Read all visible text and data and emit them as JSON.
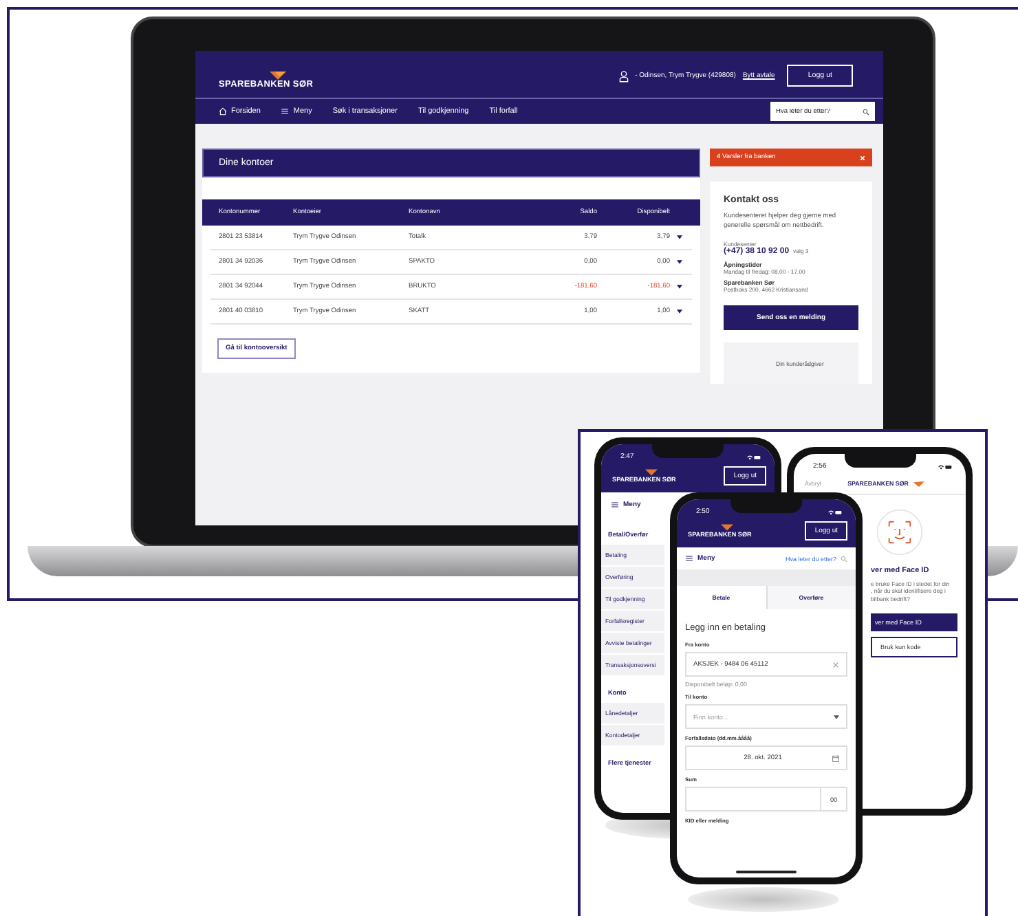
{
  "laptop": {
    "header": {
      "logo": "SPAREBANKEN SØR",
      "user": "- Odinsen, Trym Trygve (429808)",
      "switch_link": "Bytt avtale",
      "logout": "Logg ut"
    },
    "nav": {
      "items": [
        {
          "label": "Forsiden"
        },
        {
          "label": "Meny"
        },
        {
          "label": "Søk i transaksjoner"
        },
        {
          "label": "Til godkjenning"
        },
        {
          "label": "Til forfall"
        }
      ],
      "search": {
        "placeholder": "Hva leter du etter?"
      }
    },
    "accounts": {
      "title": "Dine kontoer",
      "columns": [
        "Kontonummer",
        "Kontoeier",
        "Kontonavn",
        "Saldo",
        "Disponibelt"
      ],
      "rows": [
        {
          "number": "2801 23 53814",
          "owner": "Trym Trygve Odinsen",
          "name": "Totalk",
          "balance": "3,79",
          "available": "3,79",
          "negative": false
        },
        {
          "number": "2801 34 92036",
          "owner": "Trym Trygve Odinsen",
          "name": "SPAKTO",
          "balance": "0,00",
          "available": "0,00",
          "negative": false
        },
        {
          "number": "2801 34 92044",
          "owner": "Trym Trygve Odinsen",
          "name": "BRUKTO",
          "balance": "-181,60",
          "available": "-181,60",
          "negative": true
        },
        {
          "number": "2801 40 03810",
          "owner": "Trym Trygve Odinsen",
          "name": "SKATT",
          "balance": "1,00",
          "available": "1,00",
          "negative": false
        }
      ],
      "button": "Gå til kontooversikt"
    },
    "alert": {
      "text": "4 Varsler fra banken"
    },
    "contact": {
      "title": "Kontakt oss",
      "intro": "Kundesenteret hjelper deg gjerne med generelle spørsmål om nettbedrift.",
      "phone_label": "Kundesenter",
      "phone": "(+47) 38 10 92 00",
      "phone_suffix": "valg 3",
      "hours_label": "Åpningstider",
      "hours": "Mandag til fredag: 08.00 - 17.00",
      "office_name": "Sparebanken Sør",
      "office_address": "Postboks 200, 4662 Kristiansand",
      "button": "Send oss en melding",
      "advisor_label": "Din kunderådgiver"
    }
  },
  "phone_menu": {
    "time": "2:47",
    "logo": "SPAREBANKEN SØR",
    "logout": "Logg ut",
    "menu": "Meny",
    "sections": [
      {
        "title": "Betal/Overfør",
        "items": [
          "Betaling",
          "Overføring",
          "Til godkjenning",
          "Forfallsregister",
          "Avviste betalinger",
          "Transaksjonsoversi"
        ]
      },
      {
        "title": "Konto",
        "items": [
          "Lånedetaljer",
          "Kontodetaljer"
        ]
      },
      {
        "title": "Flere tjenester"
      }
    ]
  },
  "phone_faceid": {
    "time": "2:56",
    "cancel": "Avbryt",
    "logo": "SPAREBANKEN SØR",
    "title": "ver med Face ID",
    "lines": [
      "e bruke Face ID i stedet for din",
      ", når du skal identifisere deg i",
      "bilbank bedrift?"
    ],
    "primary_button": "ver med Face ID",
    "secondary_button": "Bruk kun kode"
  },
  "phone_payment": {
    "time": "2:50",
    "logo": "SPAREBANKEN SØR",
    "logout": "Logg ut",
    "menu": "Meny",
    "search_link": "Hva leter du etter?",
    "tabs": [
      {
        "label": "Betale",
        "selected": true
      },
      {
        "label": "Overføre",
        "selected": false
      }
    ],
    "title": "Legg inn en betaling",
    "fields": [
      {
        "kind": "clearable",
        "label": "Fra konto",
        "value": "AKSJEK - 9484 06 45112",
        "hint": "Disponibelt beløp: 0,00"
      },
      {
        "kind": "select",
        "label": "Til konto",
        "placeholder": "Finn konto..."
      },
      {
        "kind": "date",
        "label": "Forfallsdato (dd.mm.åååå)",
        "value": "28. okt. 2021"
      },
      {
        "kind": "amount",
        "label": "Sum",
        "suffix": "00"
      }
    ],
    "next_label": "KID eller melding"
  }
}
